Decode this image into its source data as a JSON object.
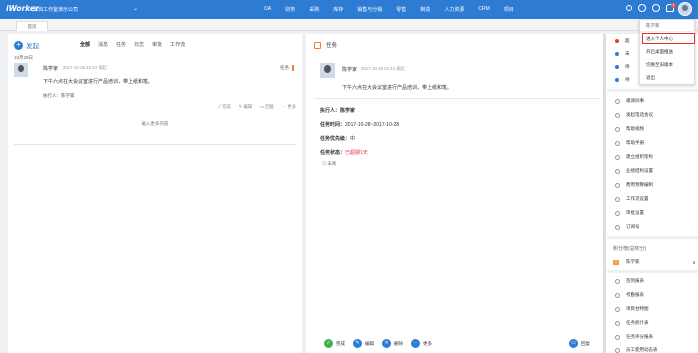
{
  "topbar": {
    "logo": "iWorker",
    "company": "深圳工作室演示公司",
    "nav": [
      "OA",
      "财务",
      "采购",
      "库存",
      "销售与分销",
      "零售",
      "制造",
      "人力资源",
      "CRM",
      "项目"
    ],
    "badge_count": "1"
  },
  "tabs": {
    "home": "首页"
  },
  "feed": {
    "new_button": "发起",
    "filters": [
      "全部",
      "消息",
      "任务",
      "日志",
      "审批",
      "工作流"
    ],
    "date": "10月28日",
    "item": {
      "user": "陈学家",
      "time": "2017-10-28 22:43 发起",
      "tag": "任务",
      "content": "下午六点在大会议室进行产品培训，带上纸和笔。",
      "executor": "执行人：陈学家",
      "actions": [
        "完成",
        "编辑",
        "回复",
        "更多"
      ]
    },
    "load_more": "载入更多内容"
  },
  "detail": {
    "header": "任务",
    "user": "陈学家",
    "time": "2017-10-28 22:43 发起",
    "content": "下午六点在大会议室进行产品培训，带上纸和笔。",
    "executor": "执行人：陈学家",
    "task_time_label": "任务时间：",
    "task_time_value": "2017-10-28~2017-10-28",
    "priority_label": "任务优先级：",
    "priority_value": "中",
    "status_label": "任务状态：",
    "status_value": "已超期1天",
    "views": "未阅",
    "actions": [
      "完成",
      "编辑",
      "删除",
      "更多"
    ],
    "reply": "回复"
  },
  "sidebar": {
    "top_items": [
      "超",
      "未",
      "待",
      "待"
    ],
    "links": [
      "邀请同事",
      "发起电话会议",
      "帮助视频",
      "帮助手册",
      "建立组织架构",
      "业绩结构设置",
      "费用预算编制",
      "工作流设置",
      "审批设置",
      "订阅号"
    ],
    "rank_title": "积分榜(总积分)",
    "rank_user": "陈学家",
    "rank_score": "3",
    "reports": [
      "签到报表",
      "考勤报表",
      "项目甘特图",
      "任务统计表",
      "任务评分报表",
      "员工使用动态表"
    ],
    "status_colors": [
      "#e23c3c",
      "#2e7bd4",
      "#2e7bd4",
      "#2e7bd4"
    ]
  },
  "dropdown": {
    "user": "陈学家",
    "items": [
      "进入个人中心",
      "开启桌面推送",
      "切换至旧版本",
      "退出"
    ]
  },
  "colors": {
    "primary": "#2e7bd4",
    "accent": "#e8813a",
    "alert": "#e23c3c"
  }
}
